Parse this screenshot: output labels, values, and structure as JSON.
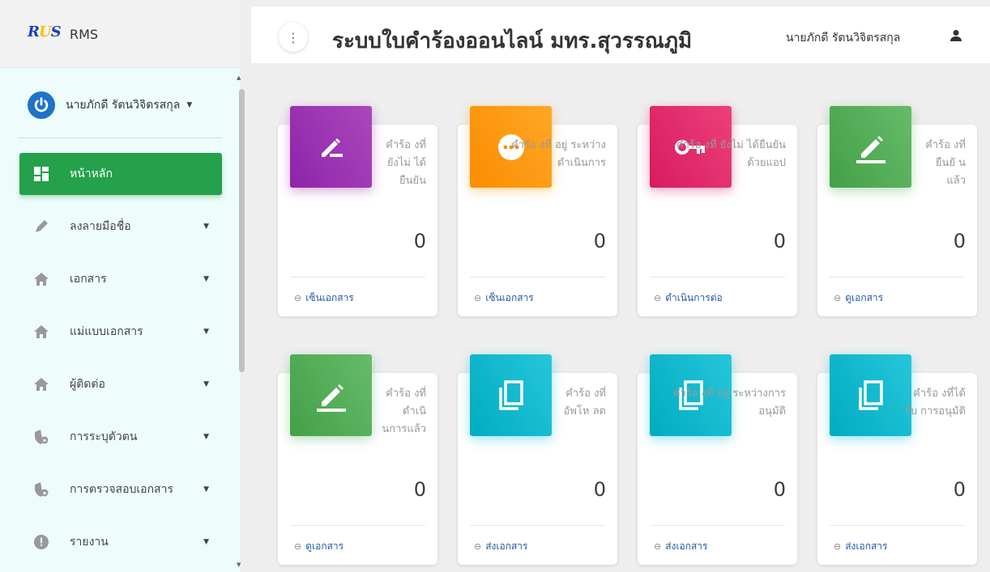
{
  "app": {
    "logo_text_r": "R",
    "logo_text_u": "U",
    "logo_text_s": "S",
    "name": "RMS"
  },
  "header": {
    "title": "ระบบใบคำร้องออนไลน์ มทร.สุวรรณภูมิ",
    "user_name": "นายภักดี รัตนวิจิตรสกุล",
    "menu_glyph": "⋮"
  },
  "sidebar": {
    "user_name": "นายภักดี รัตนวิจิตรสกุล",
    "items": [
      {
        "label": "หน้าหลัก",
        "icon": "dashboard-icon",
        "active": true
      },
      {
        "label": "ลงลายมือชื่อ",
        "icon": "pen-icon"
      },
      {
        "label": "เอกสาร",
        "icon": "home-icon"
      },
      {
        "label": "แม่แบบเอกสาร",
        "icon": "home-icon"
      },
      {
        "label": "ผู้ติดต่อ",
        "icon": "home-icon"
      },
      {
        "label": "การระบุตัวตน",
        "icon": "shield-icon"
      },
      {
        "label": "การตรวจสอบเอกสาร",
        "icon": "shield-icon"
      },
      {
        "label": "รายงาน",
        "icon": "alert-icon"
      }
    ]
  },
  "cards": [
    {
      "title": "คำร้อ งที่ ยังไม่ ได้ยืนยัน",
      "value": "0",
      "link": "เซ็นเอกสาร",
      "icon": "signature-icon",
      "color": "#9c27b0"
    },
    {
      "title": "คำร้อ งที่ อยู่ ระหว่างดำเนินการ",
      "value": "0",
      "link": "เซ็นเอกสาร",
      "icon": "more-dots-icon",
      "color": "#ff9800"
    },
    {
      "title": "คำร้อ งที่ ยังไม่ ได้ยืนยันด้วยแอป",
      "value": "0",
      "link": "ดำเนินการต่อ",
      "icon": "key-icon",
      "color": "#e91e63"
    },
    {
      "title": "คำร้อ งที่ ยืนยั นแล้ว",
      "value": "0",
      "link": "ดูเอกสาร",
      "icon": "edit-pencil-icon",
      "color": "#4caf50"
    },
    {
      "title": "คำร้อ งที่ ดำเนิ นการแล้ว",
      "value": "0",
      "link": "ดูเอกสาร",
      "icon": "edit-pencil-icon",
      "color": "#4caf50"
    },
    {
      "title": "คำร้อ งที่ อัพโห ลด",
      "value": "0",
      "link": "ส่งเอกสาร",
      "icon": "copy-icon",
      "color": "#00bcd4"
    },
    {
      "title": "คำร้อ งที่ อยู่ ระหว่างการอนุมัติ",
      "value": "0",
      "link": "ส่งเอกสาร",
      "icon": "copy-icon",
      "color": "#00bcd4"
    },
    {
      "title": "คำร้อ งที่ได้ รับ การอนุมัติ",
      "value": "0",
      "link": "ส่งเอกสาร",
      "icon": "copy-icon",
      "color": "#00bcd4"
    }
  ],
  "glyphs": {
    "caret": "▼",
    "link_icon": "⊖",
    "scroll_up": "▲",
    "scroll_down": "▼"
  }
}
